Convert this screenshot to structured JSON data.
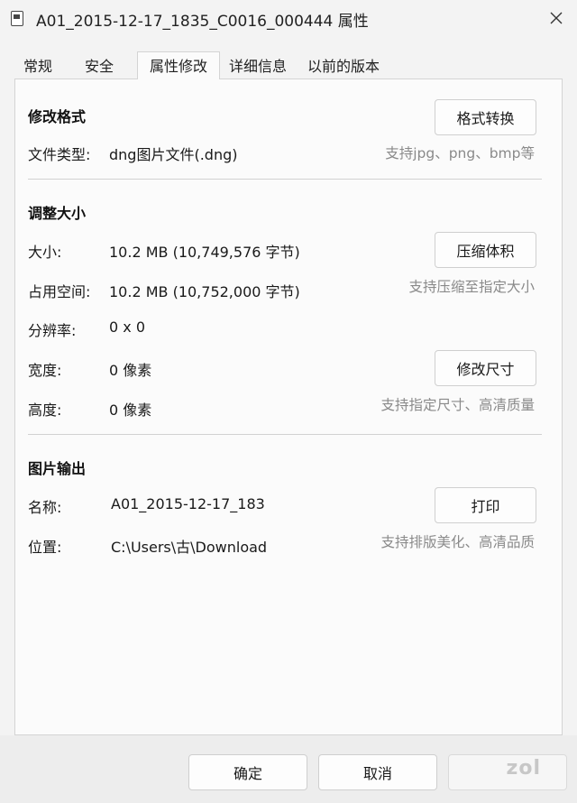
{
  "window": {
    "title": "A01_2015-12-17_1835_C0016_000444 属性"
  },
  "tabs": [
    {
      "label": "常规"
    },
    {
      "label": "安全"
    },
    {
      "label": "属性修改"
    },
    {
      "label": "详细信息"
    },
    {
      "label": "以前的版本"
    }
  ],
  "active_tab": "属性修改",
  "format_section": {
    "heading": "修改格式",
    "button": "格式转换",
    "file_type_label": "文件类型:",
    "file_type_value": "dng图片文件(.dng)",
    "hint": "支持jpg、png、bmp等"
  },
  "resize_section": {
    "heading": "调整大小",
    "size_label": "大小:",
    "size_value": "10.2 MB (10,749,576 字节)",
    "compress_button": "压缩体积",
    "space_label": "占用空间:",
    "space_value": "10.2 MB (10,752,000 字节)",
    "compress_hint": "支持压缩至指定大小",
    "resolution_label": "分辨率:",
    "resolution_value": "0 x 0",
    "width_label": "宽度:",
    "width_value": "0 像素",
    "resize_button": "修改尺寸",
    "height_label": "高度:",
    "height_value": "0 像素",
    "resize_hint": "支持指定尺寸、高清质量"
  },
  "output_section": {
    "heading": "图片输出",
    "name_label": "名称:",
    "name_value": "A01_2015-12-17_183",
    "print_button": "打印",
    "location_label": "位置:",
    "location_value": "C:\\Users\\古\\Download",
    "print_hint": "支持排版美化、高清品质"
  },
  "footer": {
    "ok": "确定",
    "cancel": "取消",
    "watermark": "zol"
  },
  "colors": {
    "window_bg": "#f3f3f3",
    "panel_bg": "#fbfbfb",
    "hint_text": "#8a8a8a",
    "border": "#d4d4d4"
  }
}
